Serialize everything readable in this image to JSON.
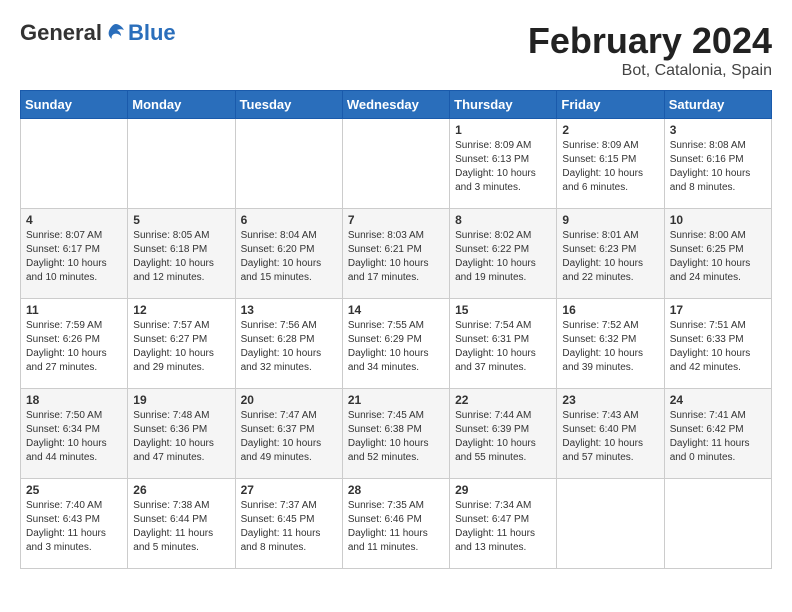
{
  "header": {
    "logo_general": "General",
    "logo_blue": "Blue",
    "title": "February 2024",
    "subtitle": "Bot, Catalonia, Spain"
  },
  "days_of_week": [
    "Sunday",
    "Monday",
    "Tuesday",
    "Wednesday",
    "Thursday",
    "Friday",
    "Saturday"
  ],
  "weeks": [
    [
      {
        "day": "",
        "info": ""
      },
      {
        "day": "",
        "info": ""
      },
      {
        "day": "",
        "info": ""
      },
      {
        "day": "",
        "info": ""
      },
      {
        "day": "1",
        "info": "Sunrise: 8:09 AM\nSunset: 6:13 PM\nDaylight: 10 hours\nand 3 minutes."
      },
      {
        "day": "2",
        "info": "Sunrise: 8:09 AM\nSunset: 6:15 PM\nDaylight: 10 hours\nand 6 minutes."
      },
      {
        "day": "3",
        "info": "Sunrise: 8:08 AM\nSunset: 6:16 PM\nDaylight: 10 hours\nand 8 minutes."
      }
    ],
    [
      {
        "day": "4",
        "info": "Sunrise: 8:07 AM\nSunset: 6:17 PM\nDaylight: 10 hours\nand 10 minutes."
      },
      {
        "day": "5",
        "info": "Sunrise: 8:05 AM\nSunset: 6:18 PM\nDaylight: 10 hours\nand 12 minutes."
      },
      {
        "day": "6",
        "info": "Sunrise: 8:04 AM\nSunset: 6:20 PM\nDaylight: 10 hours\nand 15 minutes."
      },
      {
        "day": "7",
        "info": "Sunrise: 8:03 AM\nSunset: 6:21 PM\nDaylight: 10 hours\nand 17 minutes."
      },
      {
        "day": "8",
        "info": "Sunrise: 8:02 AM\nSunset: 6:22 PM\nDaylight: 10 hours\nand 19 minutes."
      },
      {
        "day": "9",
        "info": "Sunrise: 8:01 AM\nSunset: 6:23 PM\nDaylight: 10 hours\nand 22 minutes."
      },
      {
        "day": "10",
        "info": "Sunrise: 8:00 AM\nSunset: 6:25 PM\nDaylight: 10 hours\nand 24 minutes."
      }
    ],
    [
      {
        "day": "11",
        "info": "Sunrise: 7:59 AM\nSunset: 6:26 PM\nDaylight: 10 hours\nand 27 minutes."
      },
      {
        "day": "12",
        "info": "Sunrise: 7:57 AM\nSunset: 6:27 PM\nDaylight: 10 hours\nand 29 minutes."
      },
      {
        "day": "13",
        "info": "Sunrise: 7:56 AM\nSunset: 6:28 PM\nDaylight: 10 hours\nand 32 minutes."
      },
      {
        "day": "14",
        "info": "Sunrise: 7:55 AM\nSunset: 6:29 PM\nDaylight: 10 hours\nand 34 minutes."
      },
      {
        "day": "15",
        "info": "Sunrise: 7:54 AM\nSunset: 6:31 PM\nDaylight: 10 hours\nand 37 minutes."
      },
      {
        "day": "16",
        "info": "Sunrise: 7:52 AM\nSunset: 6:32 PM\nDaylight: 10 hours\nand 39 minutes."
      },
      {
        "day": "17",
        "info": "Sunrise: 7:51 AM\nSunset: 6:33 PM\nDaylight: 10 hours\nand 42 minutes."
      }
    ],
    [
      {
        "day": "18",
        "info": "Sunrise: 7:50 AM\nSunset: 6:34 PM\nDaylight: 10 hours\nand 44 minutes."
      },
      {
        "day": "19",
        "info": "Sunrise: 7:48 AM\nSunset: 6:36 PM\nDaylight: 10 hours\nand 47 minutes."
      },
      {
        "day": "20",
        "info": "Sunrise: 7:47 AM\nSunset: 6:37 PM\nDaylight: 10 hours\nand 49 minutes."
      },
      {
        "day": "21",
        "info": "Sunrise: 7:45 AM\nSunset: 6:38 PM\nDaylight: 10 hours\nand 52 minutes."
      },
      {
        "day": "22",
        "info": "Sunrise: 7:44 AM\nSunset: 6:39 PM\nDaylight: 10 hours\nand 55 minutes."
      },
      {
        "day": "23",
        "info": "Sunrise: 7:43 AM\nSunset: 6:40 PM\nDaylight: 10 hours\nand 57 minutes."
      },
      {
        "day": "24",
        "info": "Sunrise: 7:41 AM\nSunset: 6:42 PM\nDaylight: 11 hours\nand 0 minutes."
      }
    ],
    [
      {
        "day": "25",
        "info": "Sunrise: 7:40 AM\nSunset: 6:43 PM\nDaylight: 11 hours\nand 3 minutes."
      },
      {
        "day": "26",
        "info": "Sunrise: 7:38 AM\nSunset: 6:44 PM\nDaylight: 11 hours\nand 5 minutes."
      },
      {
        "day": "27",
        "info": "Sunrise: 7:37 AM\nSunset: 6:45 PM\nDaylight: 11 hours\nand 8 minutes."
      },
      {
        "day": "28",
        "info": "Sunrise: 7:35 AM\nSunset: 6:46 PM\nDaylight: 11 hours\nand 11 minutes."
      },
      {
        "day": "29",
        "info": "Sunrise: 7:34 AM\nSunset: 6:47 PM\nDaylight: 11 hours\nand 13 minutes."
      },
      {
        "day": "",
        "info": ""
      },
      {
        "day": "",
        "info": ""
      }
    ]
  ]
}
